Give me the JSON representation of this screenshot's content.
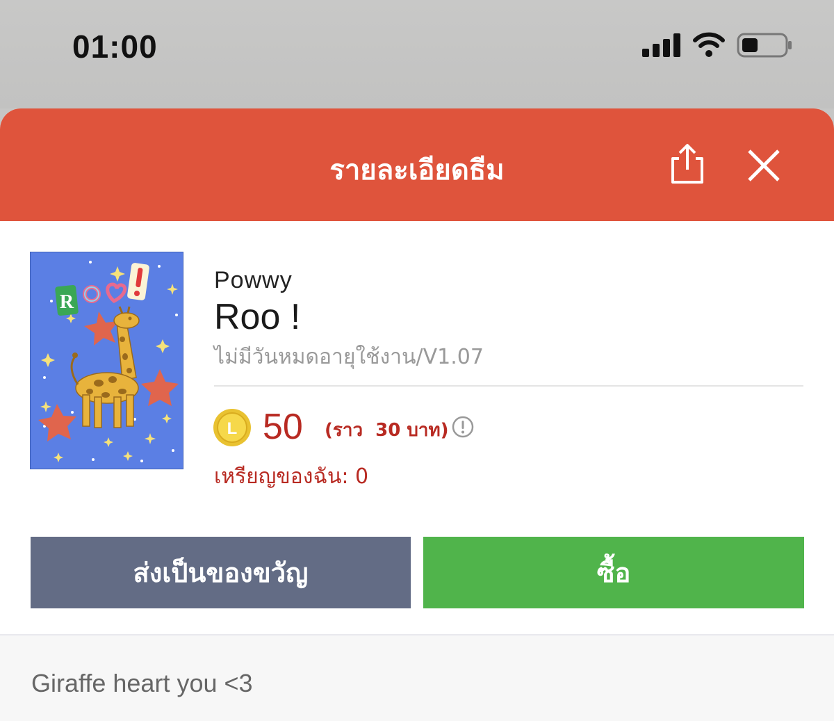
{
  "status_bar": {
    "time": "01:00"
  },
  "header": {
    "title": "รายละเอียดธีม",
    "share_icon": "share-icon",
    "close_icon": "close-icon",
    "color": "#df543c"
  },
  "theme": {
    "author": "Powwy",
    "name": "Roo !",
    "validity_version": "ไม่มีวันหมดอายุใช้งาน/V1.07",
    "thumbnail_text": [
      "R",
      "o",
      "♡",
      "!"
    ],
    "price": "50",
    "price_approx": "(ราว  30 บาท)",
    "coin_label": "L",
    "my_coins": "เหรียญของฉัน: 0",
    "accent_color": "#b82a22"
  },
  "buttons": {
    "gift_label": "ส่งเป็นของขวัญ",
    "buy_label": "ซื้อ",
    "gift_color": "#636c85",
    "buy_color": "#50b44b"
  },
  "description": {
    "text": "Giraffe heart you <3"
  }
}
